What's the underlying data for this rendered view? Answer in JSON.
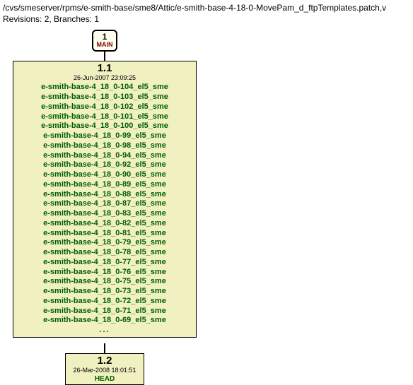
{
  "header": {
    "path": "/cvs/smeserver/rpms/e-smith-base/sme8/Attic/e-smith-base-4-18-0-MovePam_d_ftpTemplates.patch,v",
    "revisions_line": "Revisions: 2, Branches: 1"
  },
  "branch": {
    "num": "1",
    "label": "MAIN"
  },
  "rev1": {
    "title": "1.1",
    "date": "26-Jun-2007 23:09:25",
    "tags": [
      "e-smith-base-4_18_0-104_el5_sme",
      "e-smith-base-4_18_0-103_el5_sme",
      "e-smith-base-4_18_0-102_el5_sme",
      "e-smith-base-4_18_0-101_el5_sme",
      "e-smith-base-4_18_0-100_el5_sme",
      "e-smith-base-4_18_0-99_el5_sme",
      "e-smith-base-4_18_0-98_el5_sme",
      "e-smith-base-4_18_0-94_el5_sme",
      "e-smith-base-4_18_0-92_el5_sme",
      "e-smith-base-4_18_0-90_el5_sme",
      "e-smith-base-4_18_0-89_el5_sme",
      "e-smith-base-4_18_0-88_el5_sme",
      "e-smith-base-4_18_0-87_el5_sme",
      "e-smith-base-4_18_0-83_el5_sme",
      "e-smith-base-4_18_0-82_el5_sme",
      "e-smith-base-4_18_0-81_el5_sme",
      "e-smith-base-4_18_0-79_el5_sme",
      "e-smith-base-4_18_0-78_el5_sme",
      "e-smith-base-4_18_0-77_el5_sme",
      "e-smith-base-4_18_0-76_el5_sme",
      "e-smith-base-4_18_0-75_el5_sme",
      "e-smith-base-4_18_0-73_el5_sme",
      "e-smith-base-4_18_0-72_el5_sme",
      "e-smith-base-4_18_0-71_el5_sme",
      "e-smith-base-4_18_0-69_el5_sme"
    ],
    "ellipsis": "..."
  },
  "rev2": {
    "title": "1.2",
    "date": "26-Mar-2008 18:01:51",
    "head": "HEAD"
  }
}
